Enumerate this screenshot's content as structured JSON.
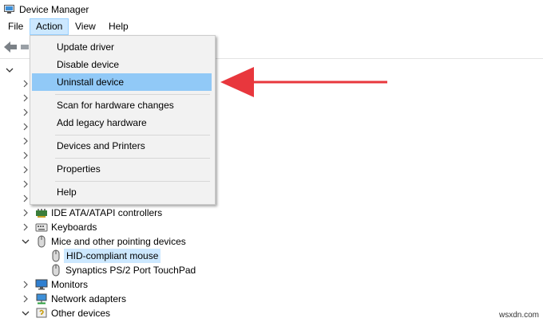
{
  "window": {
    "title": "Device Manager",
    "icon": "device-manager-icon"
  },
  "menubar": {
    "file": "File",
    "action": "Action",
    "view": "View",
    "help": "Help"
  },
  "toolbar": {
    "back_icon": "back-arrow-icon",
    "forward_icon": "forward-arrow-icon"
  },
  "action_menu": {
    "items": [
      {
        "label": "Update driver"
      },
      {
        "label": "Disable device"
      },
      {
        "label": "Uninstall device",
        "highlighted": true
      },
      {
        "label": "Scan for hardware changes"
      },
      {
        "label": "Add legacy hardware"
      },
      {
        "label": "Devices and Printers"
      },
      {
        "label": "Properties"
      },
      {
        "label": "Help"
      }
    ]
  },
  "tree": {
    "ide": "IDE ATA/ATAPI controllers",
    "keyboards": "Keyboards",
    "mice": "Mice and other pointing devices",
    "hid_mouse": "HID-compliant mouse",
    "synaptics": "Synaptics PS/2 Port TouchPad",
    "monitors": "Monitors",
    "network": "Network adapters",
    "other": "Other devices"
  },
  "annotation": {
    "arrow_color": "#e8373d"
  },
  "watermark": "wsxdn.com"
}
